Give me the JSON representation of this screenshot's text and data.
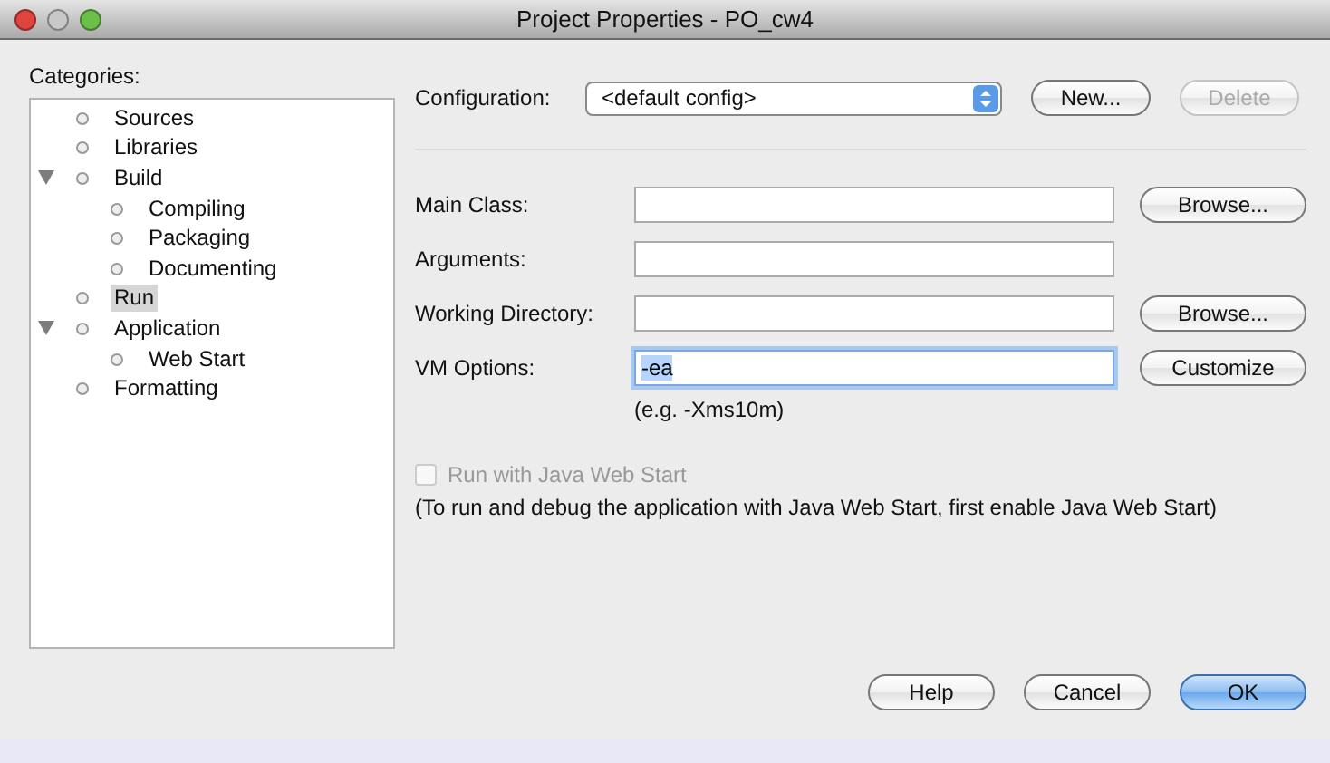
{
  "window": {
    "title": "Project Properties - PO_cw4"
  },
  "categories": {
    "label": "Categories:",
    "items": [
      {
        "label": "Sources",
        "selected": false
      },
      {
        "label": "Libraries",
        "selected": false
      },
      {
        "label": "Build",
        "selected": false,
        "expanded": true,
        "children": [
          {
            "label": "Compiling",
            "selected": false
          },
          {
            "label": "Packaging",
            "selected": false
          },
          {
            "label": "Documenting",
            "selected": false
          }
        ]
      },
      {
        "label": "Run",
        "selected": true
      },
      {
        "label": "Application",
        "selected": false,
        "expanded": true,
        "children": [
          {
            "label": "Web Start",
            "selected": false
          }
        ]
      },
      {
        "label": "Formatting",
        "selected": false
      }
    ]
  },
  "configuration": {
    "label": "Configuration:",
    "value": "<default config>",
    "buttons": [
      {
        "label": "New...",
        "disabled": false
      },
      {
        "label": "Delete",
        "disabled": true
      }
    ]
  },
  "fields": [
    {
      "label": "Main Class:",
      "focused": false,
      "button": "Browse..."
    },
    {
      "label": "Arguments:",
      "focused": false
    },
    {
      "label": "Working Directory:",
      "focused": false,
      "button": "Browse..."
    },
    {
      "label": "VM Options:",
      "value": "-ea",
      "focused": true,
      "button": "Customize",
      "hint": "(e.g. -Xms10m)"
    }
  ],
  "web_start": {
    "label": "Run with Java Web Start",
    "checked": false,
    "disabled": true,
    "note": "(To run and debug the application with Java Web Start, first enable Java Web Start)"
  },
  "buttons": [
    {
      "label": "Help",
      "default": false
    },
    {
      "label": "Cancel",
      "default": false
    },
    {
      "label": "OK",
      "default": true
    }
  ]
}
